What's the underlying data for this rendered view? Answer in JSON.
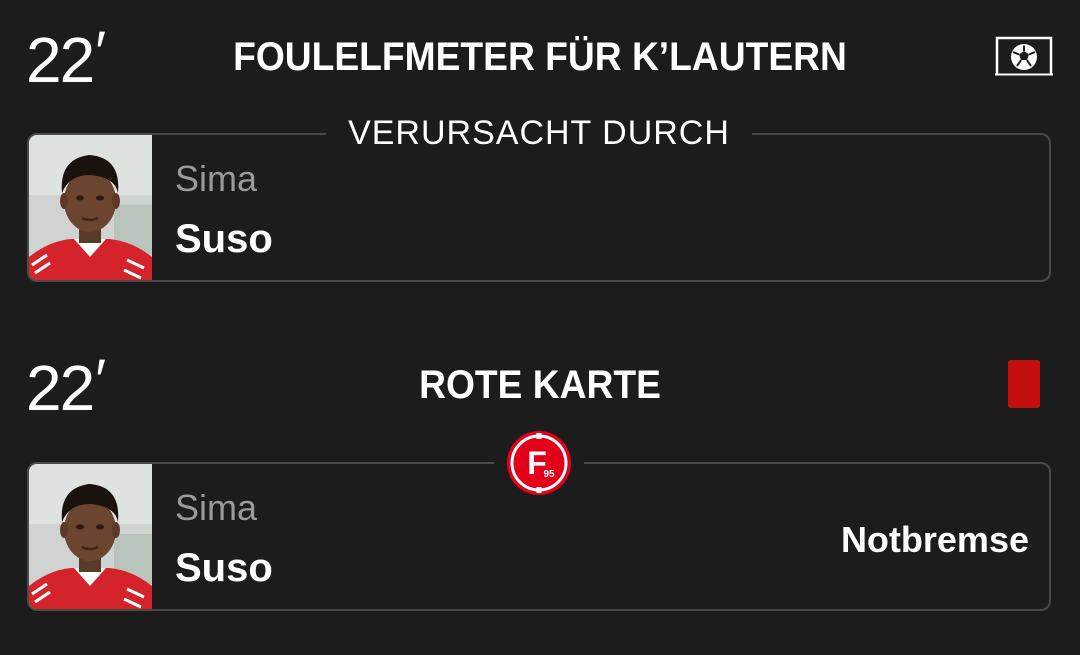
{
  "events": [
    {
      "minute": "22",
      "minute_mark": "′",
      "title": "FOULELFMETER FÜR K’LAUTERN",
      "icon": "penalty-goal-icon",
      "caption": "VERURSACHT DURCH",
      "player": {
        "first_name": "Sima",
        "last_name": "Suso"
      }
    },
    {
      "minute": "22",
      "minute_mark": "′",
      "title": "ROTE KARTE",
      "icon": "red-card-icon",
      "club_badge": "fortuna-duesseldorf-badge",
      "club_badge_text": "F",
      "club_badge_number": "95",
      "player": {
        "first_name": "Sima",
        "last_name": "Suso"
      },
      "reason": "Notbremse"
    }
  ],
  "colors": {
    "background": "#1c1c1c",
    "border": "#4a4a4a",
    "muted_text": "#9a9a9a",
    "red_card": "#c40d0d",
    "club_red": "#e2001a"
  }
}
